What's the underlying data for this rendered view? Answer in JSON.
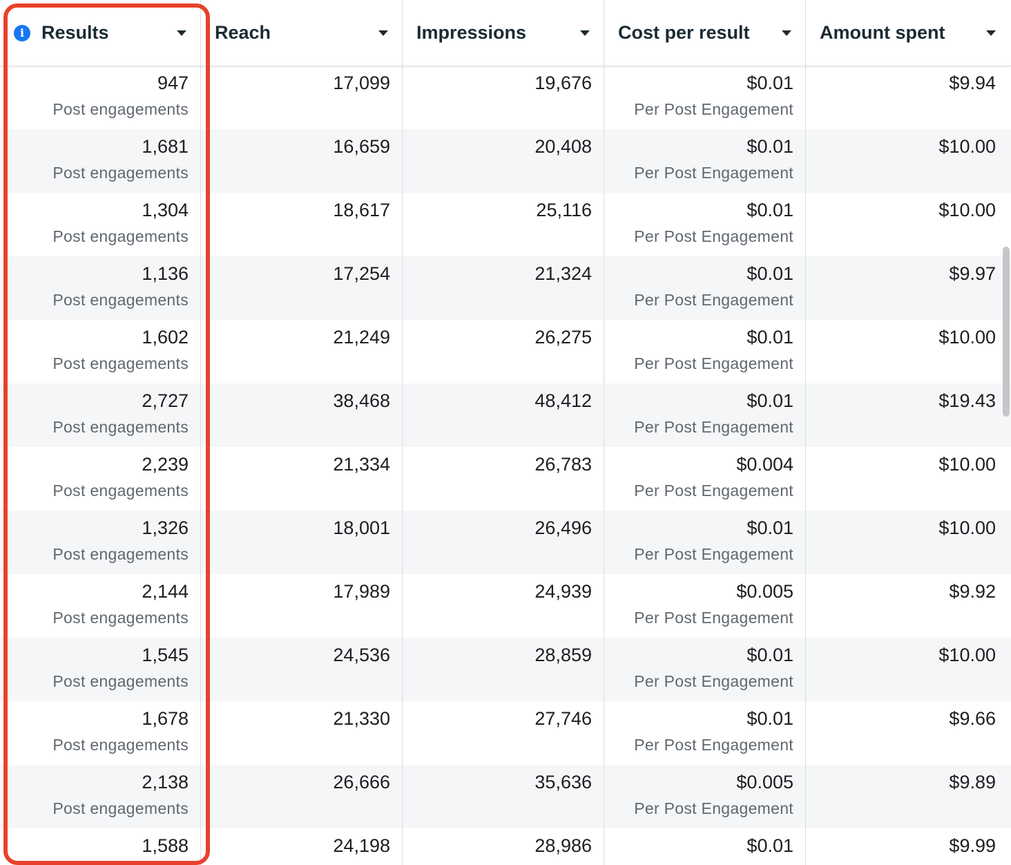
{
  "columns": [
    {
      "label": "Results",
      "has_info_icon": true
    },
    {
      "label": "Reach"
    },
    {
      "label": "Impressions"
    },
    {
      "label": "Cost per result"
    },
    {
      "label": "Amount spent"
    }
  ],
  "rows": [
    {
      "results": "947",
      "results_sub": "Post engagements",
      "reach": "17,099",
      "impressions": "19,676",
      "cost": "$0.01",
      "cost_sub": "Per Post Engagement",
      "spent": "$9.94"
    },
    {
      "results": "1,681",
      "results_sub": "Post engagements",
      "reach": "16,659",
      "impressions": "20,408",
      "cost": "$0.01",
      "cost_sub": "Per Post Engagement",
      "spent": "$10.00"
    },
    {
      "results": "1,304",
      "results_sub": "Post engagements",
      "reach": "18,617",
      "impressions": "25,116",
      "cost": "$0.01",
      "cost_sub": "Per Post Engagement",
      "spent": "$10.00"
    },
    {
      "results": "1,136",
      "results_sub": "Post engagements",
      "reach": "17,254",
      "impressions": "21,324",
      "cost": "$0.01",
      "cost_sub": "Per Post Engagement",
      "spent": "$9.97"
    },
    {
      "results": "1,602",
      "results_sub": "Post engagements",
      "reach": "21,249",
      "impressions": "26,275",
      "cost": "$0.01",
      "cost_sub": "Per Post Engagement",
      "spent": "$10.00"
    },
    {
      "results": "2,727",
      "results_sub": "Post engagements",
      "reach": "38,468",
      "impressions": "48,412",
      "cost": "$0.01",
      "cost_sub": "Per Post Engagement",
      "spent": "$19.43"
    },
    {
      "results": "2,239",
      "results_sub": "Post engagements",
      "reach": "21,334",
      "impressions": "26,783",
      "cost": "$0.004",
      "cost_sub": "Per Post Engagement",
      "spent": "$10.00"
    },
    {
      "results": "1,326",
      "results_sub": "Post engagements",
      "reach": "18,001",
      "impressions": "26,496",
      "cost": "$0.01",
      "cost_sub": "Per Post Engagement",
      "spent": "$10.00"
    },
    {
      "results": "2,144",
      "results_sub": "Post engagements",
      "reach": "17,989",
      "impressions": "24,939",
      "cost": "$0.005",
      "cost_sub": "Per Post Engagement",
      "spent": "$9.92"
    },
    {
      "results": "1,545",
      "results_sub": "Post engagements",
      "reach": "24,536",
      "impressions": "28,859",
      "cost": "$0.01",
      "cost_sub": "Per Post Engagement",
      "spent": "$10.00"
    },
    {
      "results": "1,678",
      "results_sub": "Post engagements",
      "reach": "21,330",
      "impressions": "27,746",
      "cost": "$0.01",
      "cost_sub": "Per Post Engagement",
      "spent": "$9.66"
    },
    {
      "results": "2,138",
      "results_sub": "Post engagements",
      "reach": "26,666",
      "impressions": "35,636",
      "cost": "$0.005",
      "cost_sub": "Per Post Engagement",
      "spent": "$9.89"
    },
    {
      "results": "1,588",
      "results_sub": "",
      "reach": "24,198",
      "impressions": "28,986",
      "cost": "$0.01",
      "cost_sub": "",
      "spent": "$9.99"
    }
  ],
  "colors": {
    "highlight": "#e8422b",
    "info_icon": "#1877f2",
    "alt_row": "#f5f6f7"
  }
}
